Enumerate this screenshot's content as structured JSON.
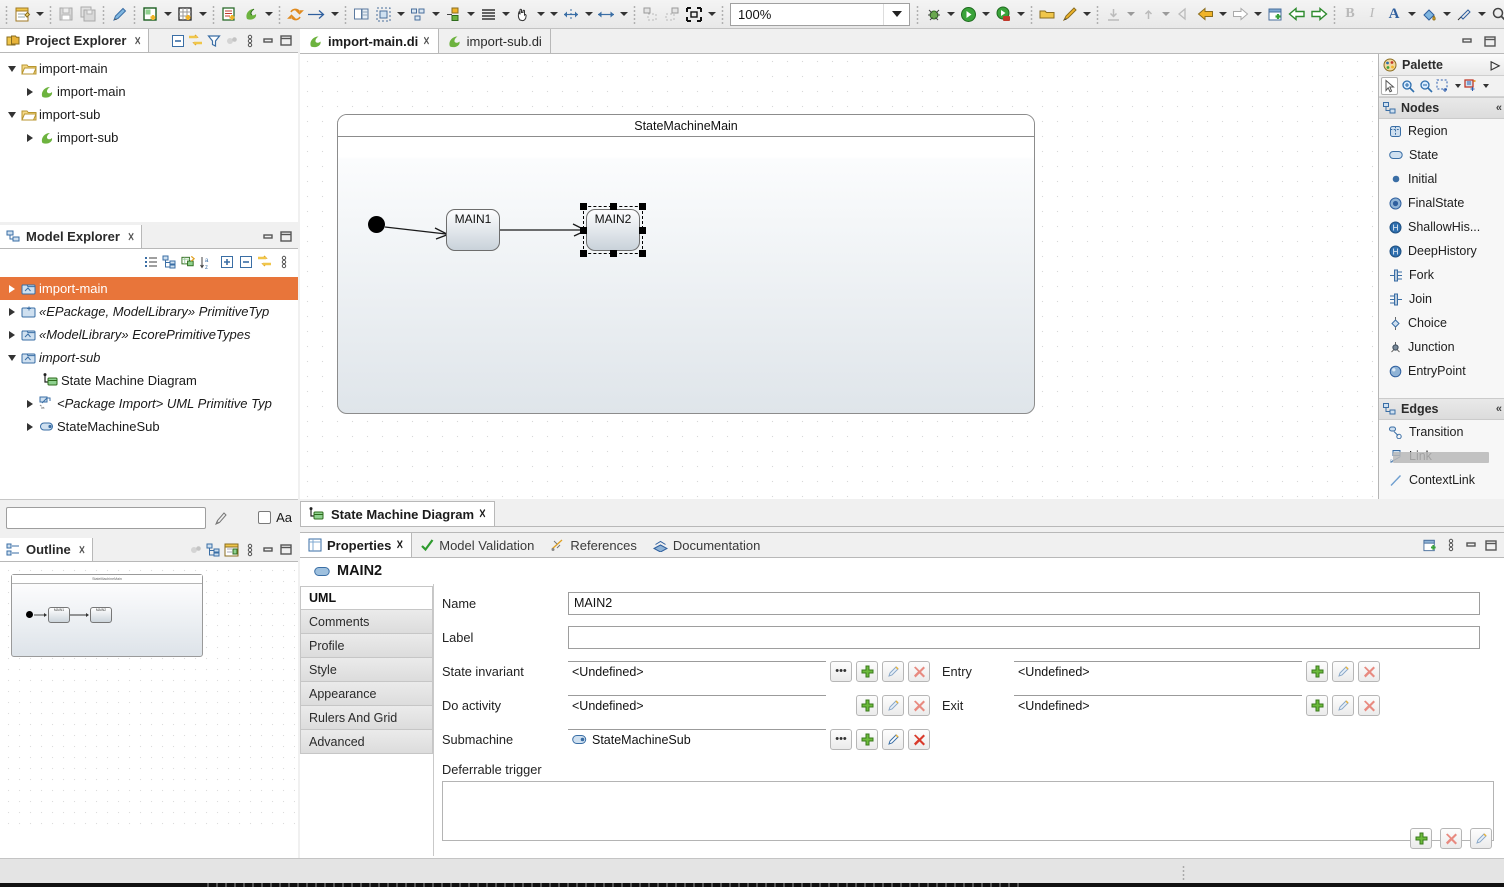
{
  "toolbar": {
    "zoom_value": "100%",
    "groups": [
      {
        "items": [
          {
            "icon": "new-wizard-icon",
            "arrow": true
          }
        ]
      },
      {
        "items": [
          {
            "icon": "save-icon",
            "arrow": false
          },
          {
            "icon": "save-all-icon",
            "arrow": false
          }
        ]
      },
      {
        "items": [
          {
            "icon": "pen-icon",
            "arrow": false
          }
        ]
      },
      {
        "items": [
          {
            "icon": "new-diagram-icon",
            "arrow": true
          },
          {
            "icon": "new-table-icon",
            "arrow": true
          }
        ]
      },
      {
        "items": [
          {
            "icon": "new-model-icon",
            "arrow": false
          },
          {
            "icon": "papyrus-icon",
            "arrow": true
          }
        ]
      },
      {
        "items": [
          {
            "icon": "refresh-sync-icon",
            "arrow": false
          },
          {
            "icon": "arrow-right-icon",
            "arrow": true
          }
        ]
      },
      {
        "items": [
          {
            "icon": "table-properties-icon",
            "arrow": false
          },
          {
            "icon": "select-all-icon",
            "arrow": true
          },
          {
            "icon": "distribute-icon",
            "arrow": true
          },
          {
            "icon": "align-nodes-icon",
            "arrow": true
          },
          {
            "icon": "text-align-icon",
            "arrow": true
          },
          {
            "icon": "hand-tool-icon",
            "arrow": true
          }
        ]
      },
      {
        "items": [
          {
            "icon": "autosize-icon",
            "arrow": true
          },
          {
            "icon": "fit-width-icon",
            "arrow": true
          }
        ]
      },
      {
        "items": [
          {
            "icon": "snap-back-icon",
            "arrow": false
          },
          {
            "icon": "snap-forward-icon",
            "arrow": false
          },
          {
            "icon": "fit-selection-icon",
            "arrow": true
          }
        ]
      },
      {
        "items": [
          {
            "icon": "debug-icon",
            "arrow": true
          },
          {
            "icon": "run-icon",
            "arrow": true
          },
          {
            "icon": "profile-icon",
            "arrow": true
          }
        ]
      },
      {
        "items": [
          {
            "icon": "open-folder-icon",
            "arrow": false
          },
          {
            "icon": "paintbrush-icon",
            "arrow": true
          }
        ]
      },
      {
        "items": [
          {
            "icon": "step-into-icon",
            "arrow": true
          },
          {
            "icon": "step-out-icon",
            "arrow": true
          },
          {
            "icon": "back-history-icon",
            "arrow": false
          },
          {
            "icon": "back-arrow-icon",
            "arrow": true
          },
          {
            "icon": "forward-arrow-icon",
            "arrow": true
          }
        ]
      },
      {
        "items": [
          {
            "icon": "new-window-icon",
            "arrow": false
          },
          {
            "icon": "prev-annotation-icon",
            "arrow": false
          },
          {
            "icon": "next-annotation-icon",
            "arrow": false
          }
        ]
      },
      {
        "items": [
          {
            "icon": "bold-icon",
            "arrow": false
          },
          {
            "icon": "italic-icon",
            "arrow": false
          },
          {
            "icon": "font-color-icon",
            "arrow": true
          },
          {
            "icon": "fill-color-icon",
            "arrow": true
          },
          {
            "icon": "line-color-icon",
            "arrow": true
          }
        ]
      },
      {
        "items": [
          {
            "icon": "search-icon",
            "arrow": false
          }
        ]
      },
      {
        "items": [
          {
            "icon": "perspective-icon",
            "arrow": false
          },
          {
            "icon": "papyrus-perspective-icon",
            "arrow": false
          }
        ]
      }
    ]
  },
  "project_explorer": {
    "title": "Project Explorer",
    "close_glyph": "☓",
    "toolbar_icons": [
      "collapse-all-icon",
      "link-with-editor-icon",
      "filter-icon",
      "focus-icon",
      "view-menu-icon",
      "minimize-icon",
      "maximize-icon"
    ],
    "tree": [
      {
        "label": "import-main",
        "indent": 0,
        "twist": "open",
        "icon": "folder-icon",
        "italic": false
      },
      {
        "label": "import-main",
        "indent": 1,
        "twist": "closed",
        "icon": "papyrus-icon",
        "italic": false
      },
      {
        "label": "import-sub",
        "indent": 0,
        "twist": "open",
        "icon": "folder-icon",
        "italic": false
      },
      {
        "label": "import-sub",
        "indent": 1,
        "twist": "closed",
        "icon": "papyrus-icon",
        "italic": false
      }
    ]
  },
  "model_explorer": {
    "title": "Model Explorer",
    "close_glyph": "☓",
    "toolbar_icons": [
      "list-icon",
      "tree-layout-icon",
      "link-editor-icon",
      "sort-az-icon",
      "expand-all-icon",
      "collapse-all-icon",
      "sync-icon",
      "view-menu-icon"
    ],
    "header_buttons": [
      "minimize-icon",
      "maximize-icon"
    ],
    "tree": [
      {
        "label": "import-main",
        "indent": 0,
        "twist": "closed",
        "icon": "model-icon",
        "italic": false,
        "selected": true
      },
      {
        "label": "«EPackage, ModelLibrary» PrimitiveTyp",
        "indent": 0,
        "twist": "closed",
        "icon": "profile-model-icon",
        "italic": true,
        "selected": false
      },
      {
        "label": "«ModelLibrary» EcorePrimitiveTypes",
        "indent": 0,
        "twist": "closed",
        "icon": "model-icon",
        "italic": true,
        "selected": false
      },
      {
        "label": "import-sub",
        "indent": 0,
        "twist": "open",
        "icon": "model-icon",
        "italic": true,
        "selected": false
      },
      {
        "label": "State Machine Diagram",
        "indent": 1,
        "twist": "none",
        "icon": "state-machine-diagram-icon",
        "italic": false,
        "selected": false
      },
      {
        "label": "<Package Import> UML Primitive Typ",
        "indent": 1,
        "twist": "closed",
        "icon": "package-import-icon",
        "italic": true,
        "selected": false
      },
      {
        "label": "StateMachineSub",
        "indent": 1,
        "twist": "closed",
        "icon": "state-machine-icon",
        "italic": false,
        "selected": false
      }
    ],
    "search": {
      "value": "",
      "placeholder": "",
      "pen_icon": "pen-icon",
      "case_checkbox_label": "Aa",
      "case_checked": false
    }
  },
  "outline": {
    "title": "Outline",
    "close_glyph": "☓",
    "toolbar_icons": [
      "focus-icon",
      "tree-outline-icon",
      "overview-icon",
      "view-menu-icon",
      "minimize-icon",
      "maximize-icon"
    ],
    "thumbnail": {
      "frame_title": "StateMachineMain",
      "states": [
        "MAIN1",
        "MAIN2"
      ]
    }
  },
  "editor": {
    "tabs": [
      {
        "label": "import-main.di",
        "active": true,
        "icon": "papyrus-icon",
        "close_glyph": "☓"
      },
      {
        "label": "import-sub.di",
        "active": false,
        "icon": "papyrus-icon",
        "close_glyph": ""
      }
    ],
    "header_buttons": [
      "minimize-icon",
      "maximize-icon"
    ],
    "diagram": {
      "frame_title": "StateMachineMain",
      "initial_node": "initial-state-node",
      "states": [
        {
          "name": "MAIN1",
          "selected": false
        },
        {
          "name": "MAIN2",
          "selected": true
        }
      ],
      "transitions": 2
    },
    "diagram_tab": {
      "label": "State Machine Diagram",
      "icon": "state-machine-diagram-icon",
      "close_glyph": "☓"
    }
  },
  "palette": {
    "title": "Palette",
    "expand_glyph": "▷",
    "tools": [
      "select-tool-icon",
      "zoom-in-icon",
      "zoom-out-icon",
      "marquee-icon",
      "note-attachment-icon"
    ],
    "groups": [
      {
        "name": "Nodes",
        "collapse_glyph": "«",
        "items": [
          {
            "label": "Region",
            "icon": "region-icon"
          },
          {
            "label": "State",
            "icon": "state-icon"
          },
          {
            "label": "Initial",
            "icon": "initial-icon"
          },
          {
            "label": "FinalState",
            "icon": "finalstate-icon"
          },
          {
            "label": "ShallowHis...",
            "icon": "shallow-history-icon"
          },
          {
            "label": "DeepHistory",
            "icon": "deep-history-icon"
          },
          {
            "label": "Fork",
            "icon": "fork-icon"
          },
          {
            "label": "Join",
            "icon": "join-icon"
          },
          {
            "label": "Choice",
            "icon": "choice-icon"
          },
          {
            "label": "Junction",
            "icon": "junction-icon"
          },
          {
            "label": "EntryPoint",
            "icon": "entrypoint-icon"
          }
        ]
      },
      {
        "name": "Edges",
        "collapse_glyph": "«",
        "items": [
          {
            "label": "Transition",
            "icon": "transition-icon"
          },
          {
            "label": "Link",
            "icon": "link-icon"
          },
          {
            "label": "ContextLink",
            "icon": "contextlink-icon"
          }
        ]
      }
    ]
  },
  "properties": {
    "tabs": [
      {
        "label": "Properties",
        "active": true,
        "icon": "properties-icon",
        "close_glyph": "☓"
      },
      {
        "label": "Model Validation",
        "active": false,
        "icon": "validation-check-icon",
        "close_glyph": ""
      },
      {
        "label": "References",
        "active": false,
        "icon": "references-icon",
        "close_glyph": ""
      },
      {
        "label": "Documentation",
        "active": false,
        "icon": "documentation-icon",
        "close_glyph": ""
      }
    ],
    "header_buttons": [
      "new-properties-view-icon",
      "view-menu-icon",
      "minimize-icon",
      "maximize-icon"
    ],
    "selected_element": {
      "name": "MAIN2",
      "icon": "state-icon"
    },
    "vertical_tabs": [
      {
        "label": "UML",
        "selected": true
      },
      {
        "label": "Comments",
        "selected": false
      },
      {
        "label": "Profile",
        "selected": false
      },
      {
        "label": "Style",
        "selected": false
      },
      {
        "label": "Appearance",
        "selected": false
      },
      {
        "label": "Rulers And Grid",
        "selected": false
      },
      {
        "label": "Advanced",
        "selected": false
      }
    ],
    "fields": {
      "name": {
        "label": "Name",
        "value": "MAIN2"
      },
      "label": {
        "label": "Label",
        "value": ""
      },
      "state_invariant": {
        "label": "State invariant",
        "value": "<Undefined>",
        "buttons": [
          "browse-ellipsis-button",
          "add-green-plus-button",
          "edit-pencil-button",
          "delete-red-x-button"
        ]
      },
      "do_activity": {
        "label": "Do activity",
        "value": "<Undefined>",
        "buttons": [
          "add-green-plus-button",
          "edit-pencil-button",
          "delete-red-x-button"
        ]
      },
      "submachine": {
        "label": "Submachine",
        "value": "StateMachineSub",
        "icon": "state-machine-icon",
        "buttons": [
          "browse-ellipsis-button",
          "add-green-plus-button",
          "edit-pencil-button",
          "delete-red-x-button"
        ]
      },
      "entry": {
        "label": "Entry",
        "value": "<Undefined>",
        "buttons": [
          "add-green-plus-button",
          "edit-pencil-button",
          "delete-red-x-button"
        ]
      },
      "exit": {
        "label": "Exit",
        "value": "<Undefined>",
        "buttons": [
          "add-green-plus-button",
          "edit-pencil-button",
          "delete-red-x-button"
        ]
      },
      "deferrable_trigger": {
        "label": "Deferrable trigger",
        "value": "",
        "buttons": [
          "add-green-plus-button",
          "delete-red-x-button",
          "edit-pencil-button"
        ]
      }
    },
    "ellipsis_glyph": "•••"
  },
  "colors": {
    "selection_orange": "#e8753a",
    "accent_blue": "#3a6ea5",
    "green_plus": "#5aa02c",
    "red_x": "#d93a2b",
    "state_fill_top": "#fdfdfe",
    "state_fill_bottom": "#c9d2da"
  }
}
